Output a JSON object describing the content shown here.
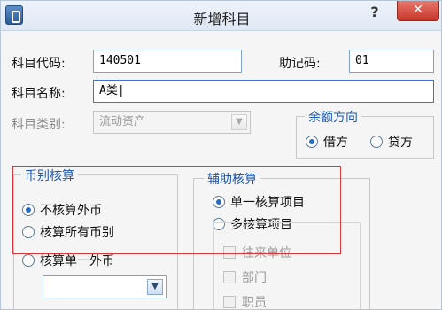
{
  "window": {
    "title": "新增科目",
    "help": "?",
    "close": "✕"
  },
  "form": {
    "code_label": "科目代码:",
    "code_value": "140501",
    "mnemonic_label": "助记码:",
    "mnemonic_value": "01",
    "name_label": "科目名称:",
    "name_value": "A类|",
    "category_label": "科目类别:",
    "category_value": "流动资产"
  },
  "balance": {
    "title": "余额方向",
    "options": [
      {
        "label": "借方",
        "selected": true
      },
      {
        "label": "贷方",
        "selected": false
      }
    ]
  },
  "currency": {
    "title": "币别核算",
    "options": [
      {
        "label": "不核算外币",
        "selected": true
      },
      {
        "label": "核算所有币别",
        "selected": false
      },
      {
        "label": "核算单一外币",
        "selected": false
      }
    ],
    "select_value": ""
  },
  "auxiliary": {
    "title": "辅助核算",
    "options": [
      {
        "label": "单一核算项目",
        "selected": true
      },
      {
        "label": "多核算项目",
        "selected": false
      }
    ],
    "items": [
      {
        "label": "往来单位",
        "checked": false
      },
      {
        "label": "部门",
        "checked": false
      },
      {
        "label": "职员",
        "checked": false
      }
    ]
  },
  "colors": {
    "highlight": "#d83a3a",
    "group_title": "#1a56b0",
    "close": "#c7372b"
  }
}
